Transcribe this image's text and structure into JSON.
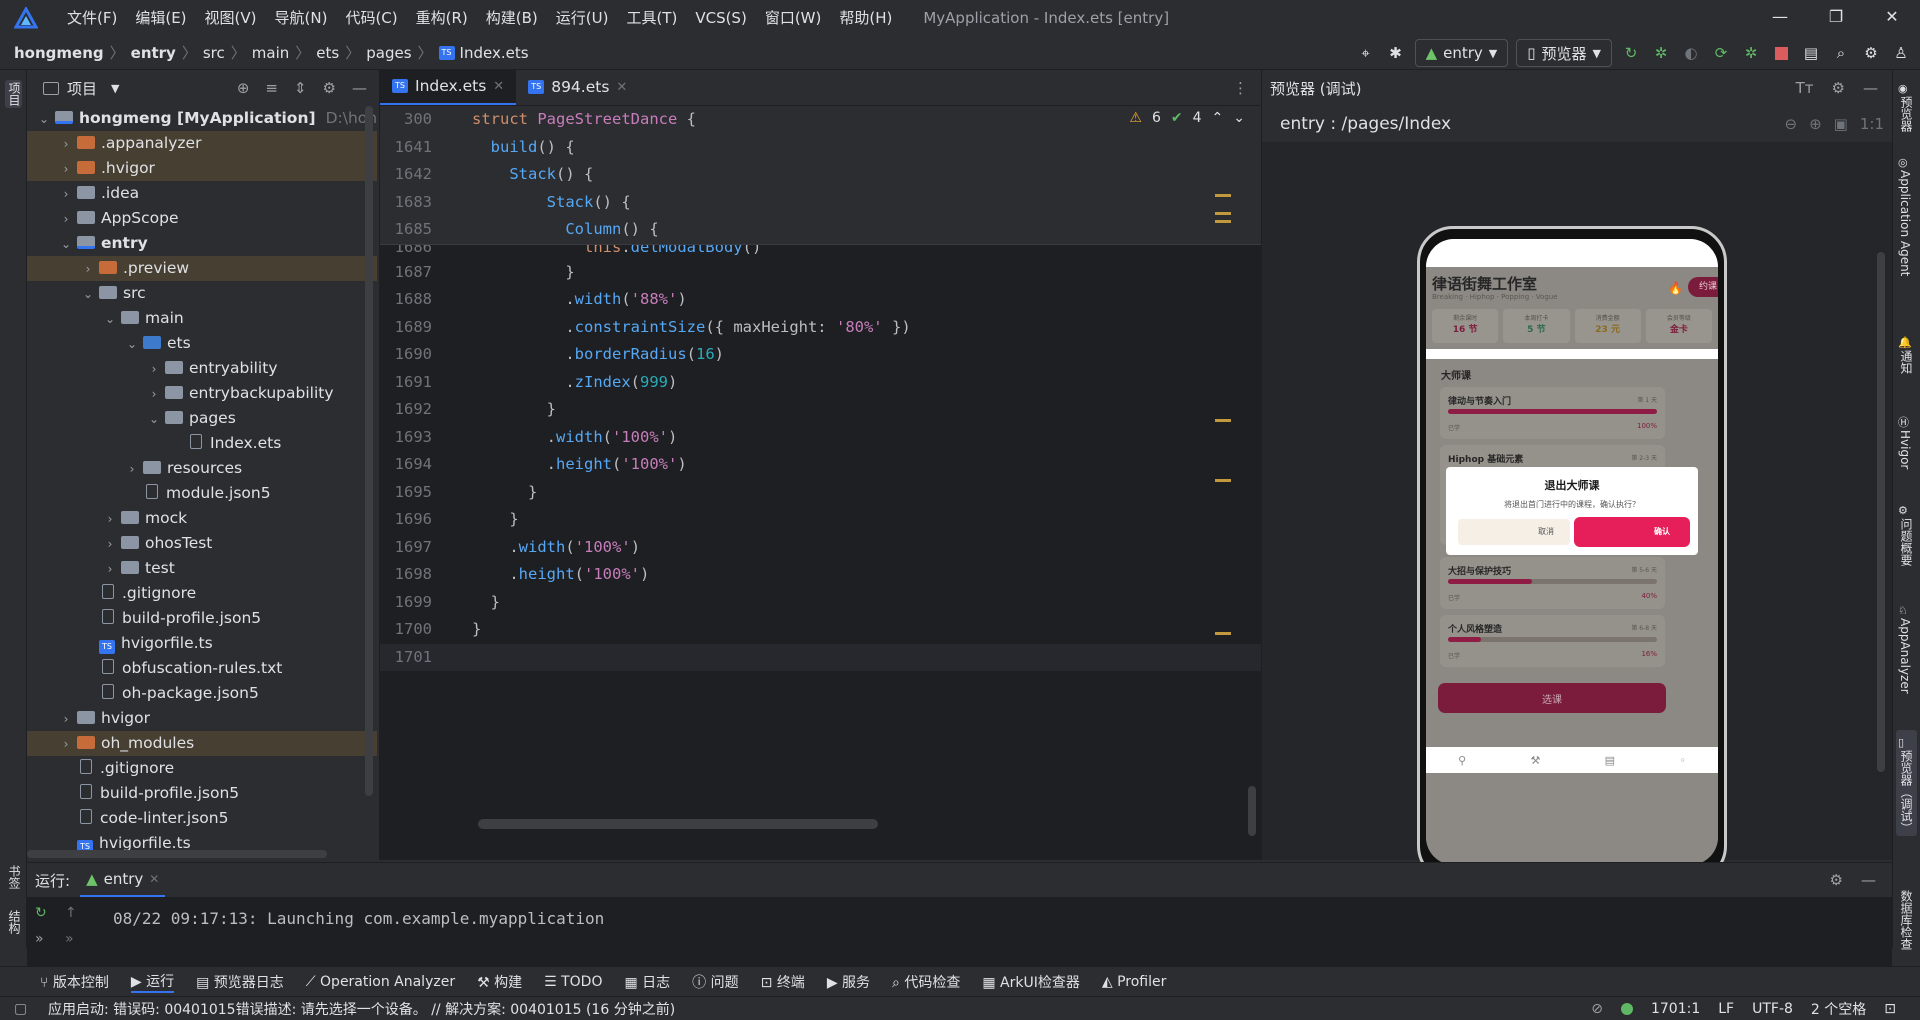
{
  "titlebar": {
    "menus": [
      "文件(F)",
      "编辑(E)",
      "视图(V)",
      "导航(N)",
      "代码(C)",
      "重构(R)",
      "构建(B)",
      "运行(U)",
      "工具(T)",
      "VCS(S)",
      "窗口(W)",
      "帮助(H)"
    ],
    "title": "MyApplication - Index.ets [entry]"
  },
  "nav": {
    "crumbs": [
      "hongmeng",
      "entry",
      "src",
      "main",
      "ets",
      "pages",
      "Index.ets"
    ],
    "module": "entry",
    "previewer": "预览器"
  },
  "left_stripe": {
    "project": "项目",
    "bookmarks": "书签",
    "structure": "结构"
  },
  "project": {
    "header": "项目",
    "tree": [
      {
        "label": "hongmeng [MyApplication]",
        "extra": "D:\\hongme",
        "depth": 0,
        "arrow": "v",
        "icon": "module"
      },
      {
        "label": ".appanalyzer",
        "depth": 1,
        "arrow": ">",
        "icon": "orange",
        "hl": true
      },
      {
        "label": ".hvigor",
        "depth": 1,
        "arrow": ">",
        "icon": "orange",
        "hl": true
      },
      {
        "label": ".idea",
        "depth": 1,
        "arrow": ">",
        "icon": "folder"
      },
      {
        "label": "AppScope",
        "depth": 1,
        "arrow": ">",
        "icon": "folder"
      },
      {
        "label": "entry",
        "depth": 1,
        "arrow": "v",
        "icon": "module",
        "bold": true
      },
      {
        "label": ".preview",
        "depth": 2,
        "arrow": ">",
        "icon": "orange",
        "hl": true
      },
      {
        "label": "src",
        "depth": 2,
        "arrow": "v",
        "icon": "folder"
      },
      {
        "label": "main",
        "depth": 3,
        "arrow": "v",
        "icon": "folder"
      },
      {
        "label": "ets",
        "depth": 4,
        "arrow": "v",
        "icon": "blue"
      },
      {
        "label": "entryability",
        "depth": 5,
        "arrow": ">",
        "icon": "folder"
      },
      {
        "label": "entrybackupability",
        "depth": 5,
        "arrow": ">",
        "icon": "folder"
      },
      {
        "label": "pages",
        "depth": 5,
        "arrow": "v",
        "icon": "folder"
      },
      {
        "label": "Index.ets",
        "depth": 6,
        "arrow": "",
        "icon": "file"
      },
      {
        "label": "resources",
        "depth": 4,
        "arrow": ">",
        "icon": "folder"
      },
      {
        "label": "module.json5",
        "depth": 4,
        "arrow": "",
        "icon": "file"
      },
      {
        "label": "mock",
        "depth": 3,
        "arrow": ">",
        "icon": "folder"
      },
      {
        "label": "ohosTest",
        "depth": 3,
        "arrow": ">",
        "icon": "folder"
      },
      {
        "label": "test",
        "depth": 3,
        "arrow": ">",
        "icon": "folder"
      },
      {
        "label": ".gitignore",
        "depth": 2,
        "arrow": "",
        "icon": "file"
      },
      {
        "label": "build-profile.json5",
        "depth": 2,
        "arrow": "",
        "icon": "file"
      },
      {
        "label": "hvigorfile.ts",
        "depth": 2,
        "arrow": "",
        "icon": "ts"
      },
      {
        "label": "obfuscation-rules.txt",
        "depth": 2,
        "arrow": "",
        "icon": "file"
      },
      {
        "label": "oh-package.json5",
        "depth": 2,
        "arrow": "",
        "icon": "file"
      },
      {
        "label": "hvigor",
        "depth": 1,
        "arrow": ">",
        "icon": "folder"
      },
      {
        "label": "oh_modules",
        "depth": 1,
        "arrow": ">",
        "icon": "orange",
        "hl": true
      },
      {
        "label": ".gitignore",
        "depth": 1,
        "arrow": "",
        "icon": "file"
      },
      {
        "label": "build-profile.json5",
        "depth": 1,
        "arrow": "",
        "icon": "file"
      },
      {
        "label": "code-linter.json5",
        "depth": 1,
        "arrow": "",
        "icon": "file"
      },
      {
        "label": "hvigorfile.ts",
        "depth": 1,
        "arrow": "",
        "icon": "ts"
      }
    ]
  },
  "editor": {
    "tabs": [
      {
        "label": "Index.ets",
        "active": true
      },
      {
        "label": "894.ets",
        "active": false
      }
    ],
    "warnings": "6",
    "checks": "4",
    "sticky": [
      {
        "no": "300",
        "html": "<span class='kw'>struct</span> <span class='cls'>PageStreetDance</span> <span class='pl'>{</span>"
      },
      {
        "no": "1641",
        "html": "  <span class='fn'>build</span><span class='pl'>() {</span>"
      },
      {
        "no": "1642",
        "html": "    <span class='fn'>Stack</span><span class='pl'>() {</span>"
      },
      {
        "no": "1683",
        "html": "        <span class='fn'>Stack</span><span class='pl'>() {</span>"
      },
      {
        "no": "1685",
        "html": "          <span class='fn'>Column</span><span class='pl'>() {</span>"
      }
    ],
    "lines": [
      {
        "no": "1686",
        "html": "            <span class='kw'>this</span><span class='pl'>.</span><span class='fn'>delModalBody</span><span class='pl'>()</span>"
      },
      {
        "no": "1687",
        "html": "          <span class='pl'>}</span>"
      },
      {
        "no": "1688",
        "html": "          <span class='pl'>.</span><span class='fn'>width</span><span class='pl'>(</span><span class='str'>'88%'</span><span class='pl'>)</span>"
      },
      {
        "no": "1689",
        "html": "          <span class='pl'>.</span><span class='fn'>constraintSize</span><span class='pl'>({ maxHeight: </span><span class='str'>'80%'</span><span class='pl'> })</span>"
      },
      {
        "no": "1690",
        "html": "          <span class='pl'>.</span><span class='fn'>borderRadius</span><span class='pl'>(</span><span class='num'>16</span><span class='pl'>)</span>"
      },
      {
        "no": "1691",
        "html": "          <span class='pl'>.</span><span class='fn'>zIndex</span><span class='pl'>(</span><span class='num'>999</span><span class='pl'>)</span>"
      },
      {
        "no": "1692",
        "html": "        <span class='pl'>}</span>"
      },
      {
        "no": "1693",
        "html": "        <span class='pl'>.</span><span class='fn'>width</span><span class='pl'>(</span><span class='str'>'100%'</span><span class='pl'>)</span>"
      },
      {
        "no": "1694",
        "html": "        <span class='pl'>.</span><span class='fn'>height</span><span class='pl'>(</span><span class='str'>'100%'</span><span class='pl'>)</span>"
      },
      {
        "no": "1695",
        "html": "      <span class='pl'>}</span>"
      },
      {
        "no": "1696",
        "html": "    <span class='pl'>}</span>"
      },
      {
        "no": "1697",
        "html": "    <span class='pl'>.</span><span class='fn'>width</span><span class='pl'>(</span><span class='str'>'100%'</span><span class='pl'>)</span>"
      },
      {
        "no": "1698",
        "html": "    <span class='pl'>.</span><span class='fn'>height</span><span class='pl'>(</span><span class='str'>'100%'</span><span class='pl'>)</span>"
      },
      {
        "no": "1699",
        "html": "  <span class='pl'>}</span>"
      },
      {
        "no": "1700",
        "html": "<span class='pl'>}</span>"
      },
      {
        "no": "1701",
        "html": ""
      }
    ]
  },
  "preview": {
    "header": "预览器 (调试)",
    "path": "entry : /pages/Index",
    "app": {
      "title": "律语街舞工作室",
      "subtitle": "Breaking · Hiphop · Popping · Vogue",
      "book": "约课",
      "stats": [
        {
          "k": "剩余课时",
          "v": "16 节"
        },
        {
          "k": "本周打卡",
          "v": "5 节"
        },
        {
          "k": "消费金额",
          "v": "23 元"
        },
        {
          "k": "会员等级",
          "v": "金卡"
        }
      ],
      "section": "大师课",
      "courses": [
        {
          "name": "律动与节奏入门",
          "tag": "第 1 天",
          "status": "已学",
          "pct": "100%",
          "fill": 1.0
        },
        {
          "name": "Hiphop 基础元素",
          "tag": "第 2-3 天",
          "status": "",
          "pct": "",
          "fill": 0
        },
        {
          "name": "大招与保护技巧",
          "tag": "第 5-6 天",
          "status": "已学",
          "pct": "40%",
          "fill": 0.4
        },
        {
          "name": "个人风格塑造",
          "tag": "第 6-8 天",
          "status": "已学",
          "pct": "16%",
          "fill": 0.16
        }
      ],
      "cta": "选课",
      "modal": {
        "title": "退出大师课",
        "body": "将退出首门进行中的课程，确认执行？",
        "cancel": "取消",
        "confirm": "确认"
      }
    }
  },
  "right_stripe": [
    "预览器",
    "Application Agent",
    "通知",
    "Hvigor",
    "问题概要",
    "AppAnalyzer",
    "预览器（调试）",
    "数据库检查"
  ],
  "run": {
    "label": "运行:",
    "tab": "entry",
    "output": "08/22 09:17:13: Launching com.example.myapplication"
  },
  "bottom_tools": [
    "版本控制",
    "运行",
    "预览器日志",
    "Operation Analyzer",
    "构建",
    "TODO",
    "日志",
    "问题",
    "终端",
    "服务",
    "代码检查",
    "ArkUI检查器",
    "Profiler"
  ],
  "status": {
    "message": "应用启动: 错误码: 00401015错误描述: 请先选择一个设备。 // 解决方案: 00401015 (16 分钟之前)",
    "position": "1701:1",
    "lineSep": "LF",
    "encoding": "UTF-8",
    "indent": "2 个空格"
  },
  "colors": {
    "accent": "#3574f0",
    "brand": "#c2185b",
    "warn": "#f0a732"
  }
}
